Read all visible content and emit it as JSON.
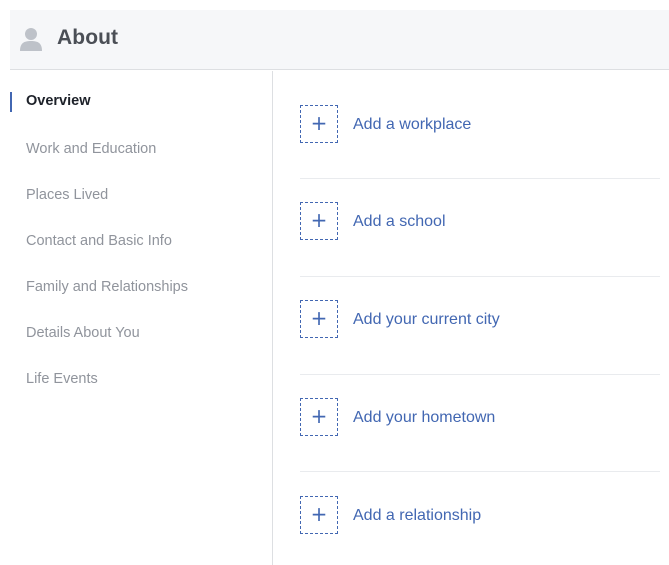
{
  "header": {
    "icon": "person-icon",
    "title": "About"
  },
  "sidebar": {
    "items": [
      {
        "label": "Overview",
        "active": true
      },
      {
        "label": "Work and Education",
        "active": false
      },
      {
        "label": "Places Lived",
        "active": false
      },
      {
        "label": "Contact and Basic Info",
        "active": false
      },
      {
        "label": "Family and Relationships",
        "active": false
      },
      {
        "label": "Details About You",
        "active": false
      },
      {
        "label": "Life Events",
        "active": false
      }
    ]
  },
  "main": {
    "add_items": [
      {
        "icon": "plus-icon",
        "label": "Add a workplace"
      },
      {
        "icon": "plus-icon",
        "label": "Add a school"
      },
      {
        "icon": "plus-icon",
        "label": "Add your current city"
      },
      {
        "icon": "plus-icon",
        "label": "Add your hometown"
      },
      {
        "icon": "plus-icon",
        "label": "Add a relationship"
      }
    ],
    "plus_glyph": "+"
  },
  "colors": {
    "accent": "#4267b2",
    "header_bg": "#f6f7f9",
    "muted_text": "#90949c",
    "dark_text": "#1d2129",
    "border": "#dddfe2"
  }
}
